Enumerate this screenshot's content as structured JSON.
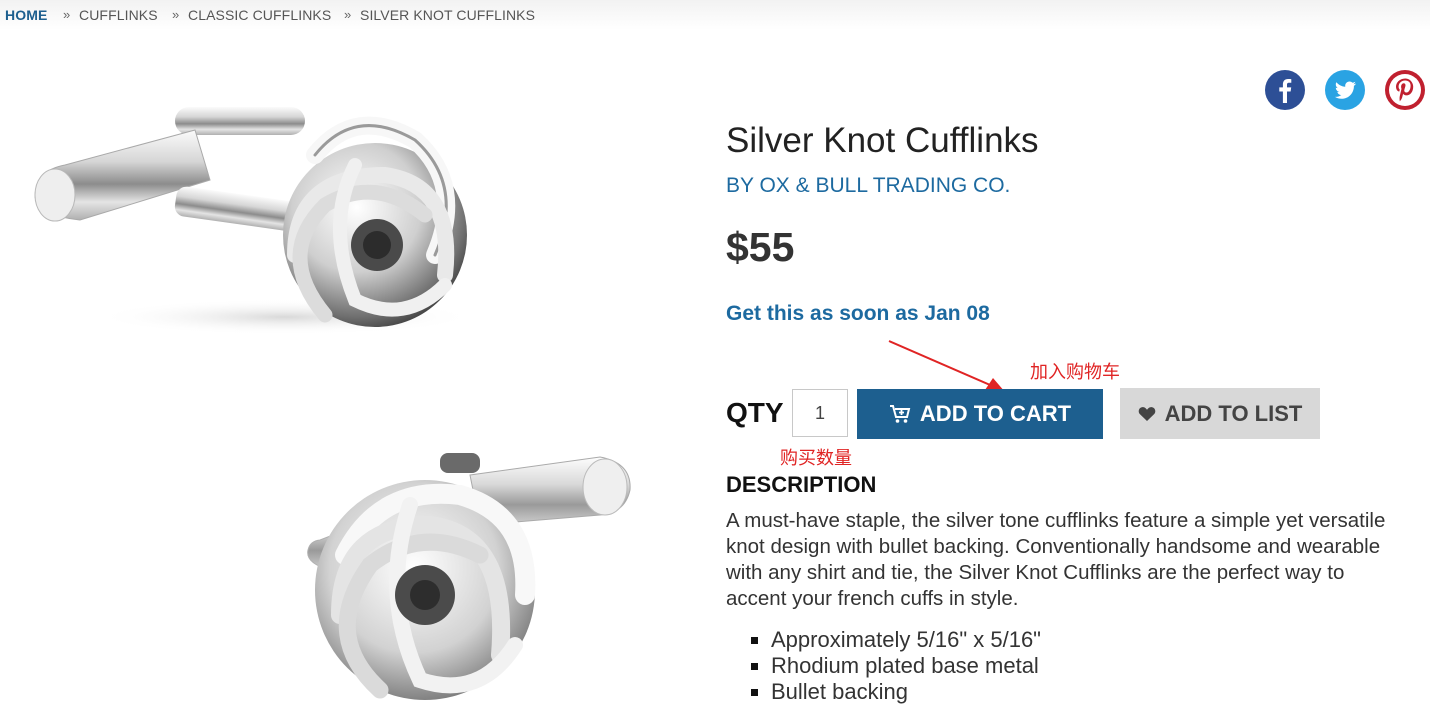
{
  "breadcrumb": {
    "home": "HOME",
    "separator": "»",
    "items": [
      "CUFFLINKS",
      "CLASSIC CUFFLINKS",
      "SILVER KNOT CUFFLINKS"
    ]
  },
  "social": {
    "icons": [
      "facebook-icon",
      "twitter-icon",
      "pinterest-icon"
    ],
    "colors": {
      "facebook": "#2d4f96",
      "twitter": "#2aa3e3",
      "pinterest": "#c0202f"
    }
  },
  "product": {
    "title": "Silver Knot Cufflinks",
    "brand": "BY OX & BULL TRADING CO.",
    "price": "$55",
    "delivery": "Get this as soon as Jan 08"
  },
  "purchase": {
    "qty_label": "QTY",
    "qty_value": "1",
    "add_to_cart": "ADD TO CART",
    "add_to_list": "ADD TO LIST",
    "cart_icon": "cart-plus-icon",
    "list_icon": "heart-icon"
  },
  "annotations": {
    "cart_note": "加入购物车",
    "qty_note": "购买数量"
  },
  "description": {
    "heading": "DESCRIPTION",
    "lines": [
      "A must-have staple, the silver tone cufflinks feature a simple yet versatile",
      "knot design with bullet backing. Conventionally handsome and wearable",
      "with any shirt and tie, the Silver Knot Cufflinks are the perfect way to",
      "accent your french cuffs in style."
    ],
    "bullets": [
      "Approximately 5/16\" x 5/16\"",
      "Rhodium plated base metal",
      "Bullet backing"
    ]
  },
  "colors": {
    "accent": "#1d5f8f",
    "link": "#1d6aa0",
    "annotation": "#e02424",
    "secondary_button": "#d8d8d8"
  }
}
